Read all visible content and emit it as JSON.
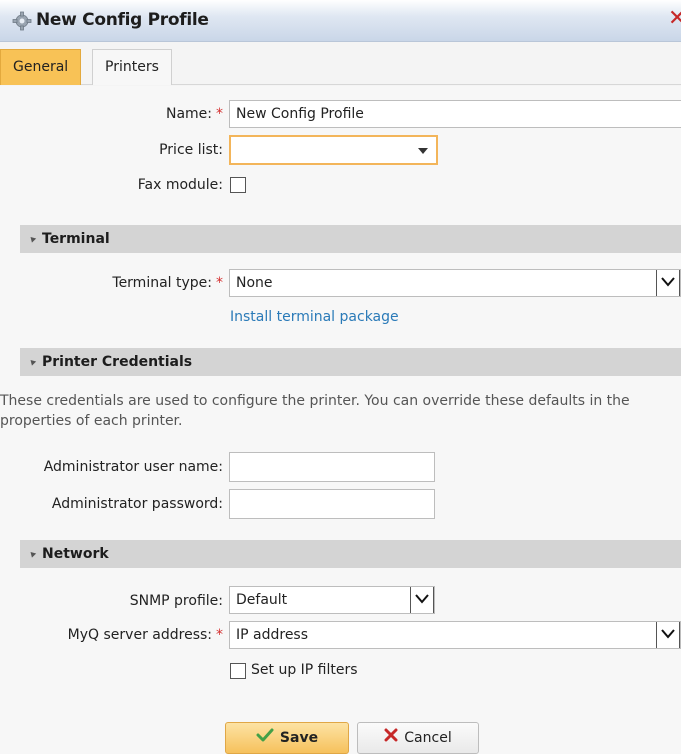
{
  "window": {
    "title": "New Config Profile",
    "icon": "gear-icon",
    "close_icon": "close-icon"
  },
  "tabs": [
    {
      "label": "General",
      "active": true
    },
    {
      "label": "Printers",
      "active": false
    }
  ],
  "general": {
    "name_label": "Name:",
    "name_value": "New Config Profile",
    "price_list_label": "Price list:",
    "price_list_value": "",
    "fax_label": "Fax module:",
    "fax_checked": false
  },
  "terminal": {
    "header": "Terminal",
    "type_label": "Terminal type:",
    "type_value": "None",
    "install_link": "Install terminal package"
  },
  "credentials": {
    "header": "Printer Credentials",
    "description": "These credentials are used to configure the printer. You can override these defaults in the properties of each printer.",
    "user_label": "Administrator user name:",
    "user_value": "",
    "password_label": "Administrator password:",
    "password_value": ""
  },
  "network": {
    "header": "Network",
    "snmp_label": "SNMP profile:",
    "snmp_value": "Default",
    "server_label": "MyQ server address:",
    "server_value": "IP address",
    "ip_filter_label": "Set up IP filters",
    "ip_filter_checked": false
  },
  "required_mark": "*",
  "buttons": {
    "save": "Save",
    "cancel": "Cancel"
  },
  "colors": {
    "accent": "#f8c256",
    "required": "#d32f2f",
    "link": "#2a7ab8",
    "cancel_x": "#c62828",
    "save_check": "#4caf50"
  }
}
